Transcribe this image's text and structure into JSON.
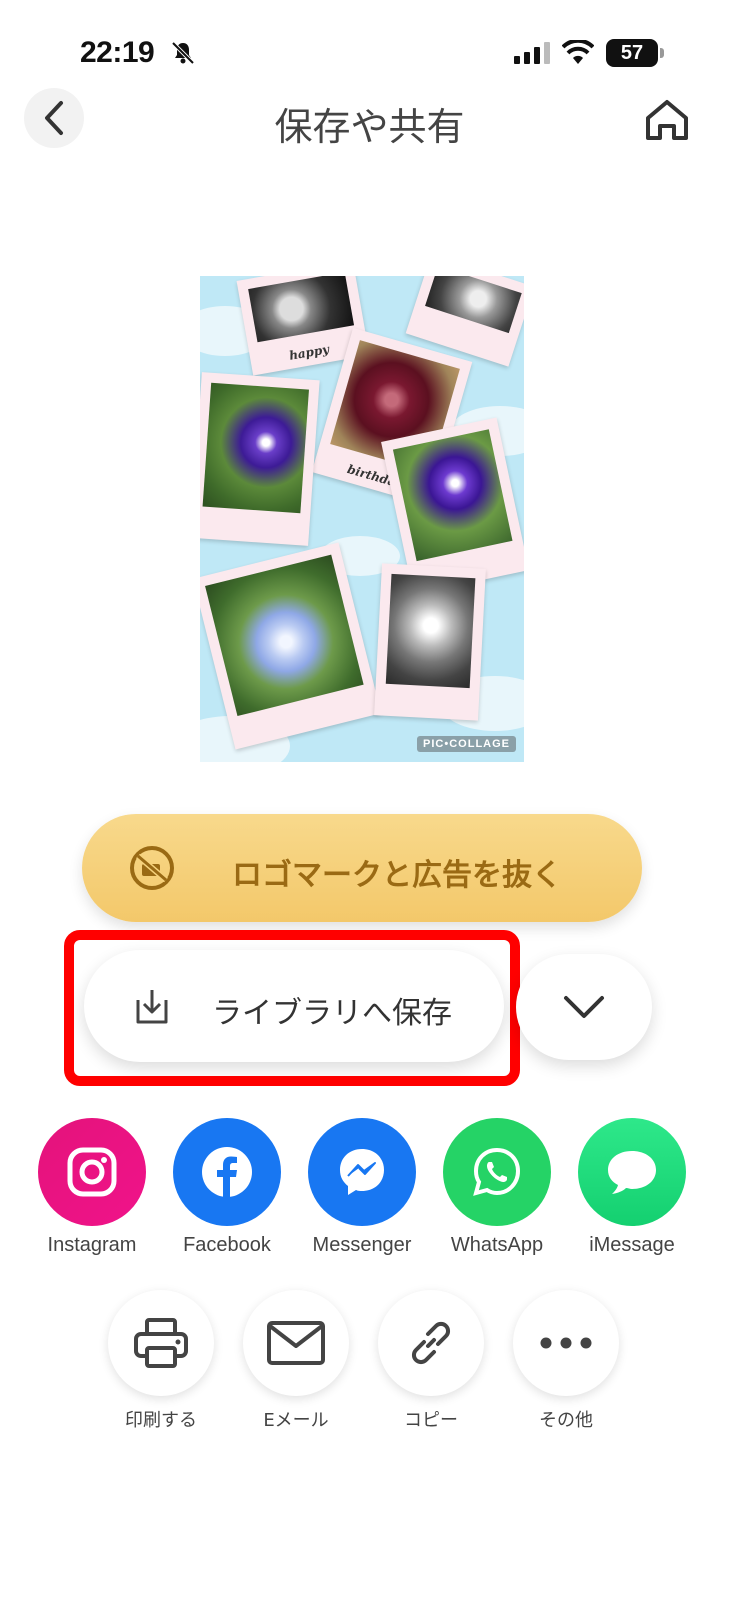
{
  "status_bar": {
    "time": "22:19",
    "battery": "57"
  },
  "header": {
    "title": "保存や共有"
  },
  "preview": {
    "caption_top": "happy",
    "caption_mid": "birthday",
    "watermark": "PIC•COLLAGE"
  },
  "remove_logo": {
    "label": "ロゴマークと広告を抜く"
  },
  "save": {
    "label": "ライブラリへ保存"
  },
  "share": [
    {
      "label": "Instagram",
      "color": "#e4137b"
    },
    {
      "label": "Facebook",
      "color": "#1877f2"
    },
    {
      "label": "Messenger",
      "color": "#1877f2"
    },
    {
      "label": "WhatsApp",
      "color": "#25d366"
    },
    {
      "label": "iMessage",
      "color": "#1fe07f"
    }
  ],
  "actions": [
    {
      "label": "印刷する",
      "icon": "printer-icon"
    },
    {
      "label": "Eメール",
      "icon": "mail-icon"
    },
    {
      "label": "コピー",
      "icon": "link-icon"
    },
    {
      "label": "その他",
      "icon": "more-icon"
    }
  ],
  "colors": {
    "highlight": "#ff0000",
    "gold": "#f3c86a"
  }
}
